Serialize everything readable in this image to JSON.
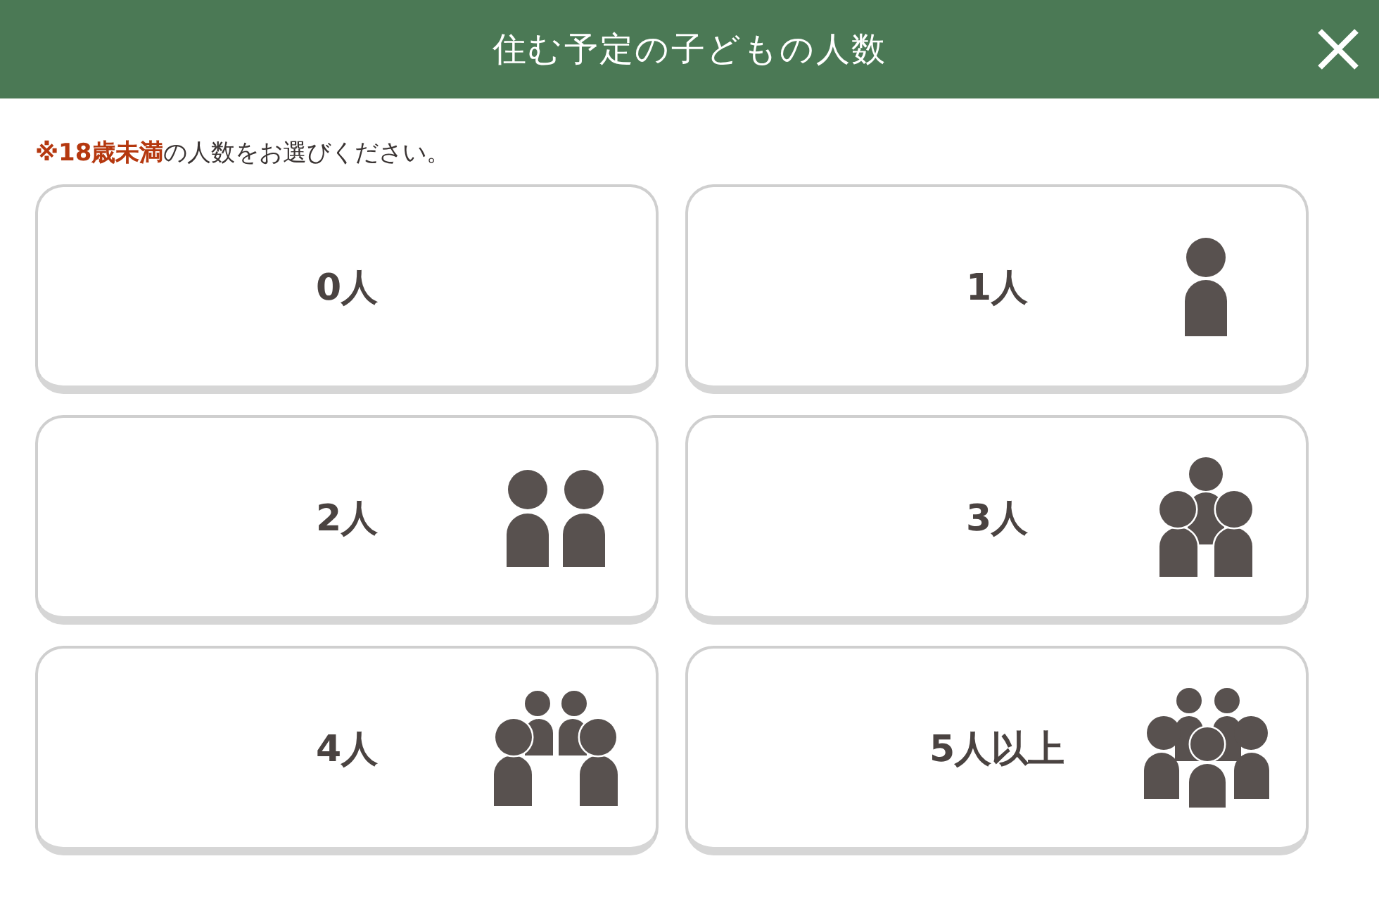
{
  "dialog": {
    "title": "住む予定の子どもの人数"
  },
  "note": "**※18歳未満**の人数をお選びください。",
  "options": [
    {
      "label": "0人",
      "selected": false
    },
    {
      "label": "1人",
      "selected": false
    },
    {
      "label": "2人",
      "selected": false
    },
    {
      "label": "3人",
      "selected": false
    },
    {
      "label": "4人",
      "selected": false
    },
    {
      "label": "5人以上",
      "selected": false
    }
  ]
}
